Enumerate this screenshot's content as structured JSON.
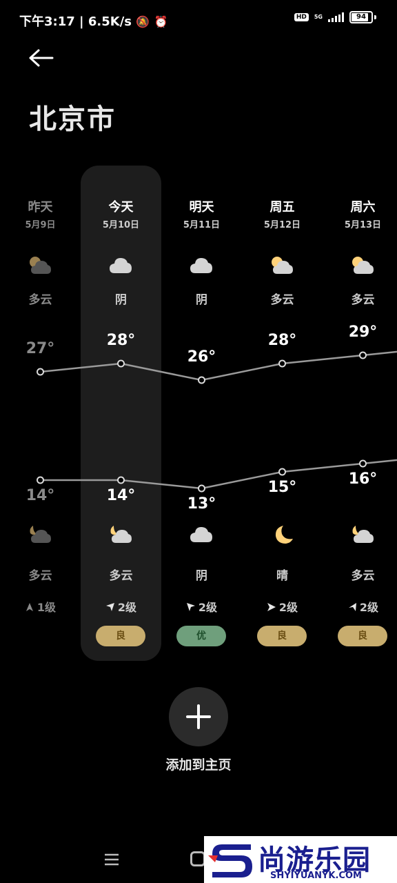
{
  "status_bar": {
    "time": "下午3:17",
    "speed": "6.5K/s",
    "hd": "HD",
    "network": "5G",
    "battery": "94",
    "battery_level_percent": 94
  },
  "page": {
    "title": "北京市"
  },
  "days": [
    {
      "name": "昨天",
      "date": "5月9日",
      "day_condition": "多云",
      "day_icon": "partly-cloudy-day-icon",
      "high": "27°",
      "low": "14°",
      "night_icon": "partly-cloudy-night-icon",
      "night_condition": "多云",
      "wind": "1级",
      "aqi": "",
      "dim": true
    },
    {
      "name": "今天",
      "date": "5月10日",
      "day_condition": "阴",
      "day_icon": "cloud-icon",
      "high": "28°",
      "low": "14°",
      "night_icon": "partly-cloudy-night-icon",
      "night_condition": "多云",
      "wind": "2级",
      "aqi": "良",
      "dim": false
    },
    {
      "name": "明天",
      "date": "5月11日",
      "day_condition": "阴",
      "day_icon": "cloud-icon",
      "high": "26°",
      "low": "13°",
      "night_icon": "cloud-icon",
      "night_condition": "阴",
      "wind": "2级",
      "aqi": "优",
      "dim": false
    },
    {
      "name": "周五",
      "date": "5月12日",
      "day_condition": "多云",
      "day_icon": "partly-cloudy-day-icon",
      "high": "28°",
      "low": "15°",
      "night_icon": "moon-icon",
      "night_condition": "晴",
      "wind": "2级",
      "aqi": "良",
      "dim": false
    },
    {
      "name": "周六",
      "date": "5月13日",
      "day_condition": "多云",
      "day_icon": "partly-cloudy-day-icon",
      "high": "29°",
      "low": "16°",
      "night_icon": "partly-cloudy-night-icon",
      "night_condition": "多云",
      "wind": "2级",
      "aqi": "良",
      "dim": false
    }
  ],
  "chart_data": {
    "type": "line",
    "categories": [
      "昨天",
      "今天",
      "明天",
      "周五",
      "周六"
    ],
    "series": [
      {
        "values": [
          27,
          28,
          26,
          28,
          29
        ]
      },
      {
        "values": [
          14,
          14,
          13,
          15,
          16
        ]
      }
    ]
  },
  "aqi_colors": {
    "良": "#c8ad6e",
    "优": "#6f9f7c"
  },
  "aqi_text_colors": {
    "良": "#6b4f14",
    "优": "#1f4f2c"
  },
  "add_button": {
    "label": "添加到主页"
  },
  "watermark": {
    "brand": "尚游乐园",
    "url": "SHYIYUANYK.COM"
  }
}
